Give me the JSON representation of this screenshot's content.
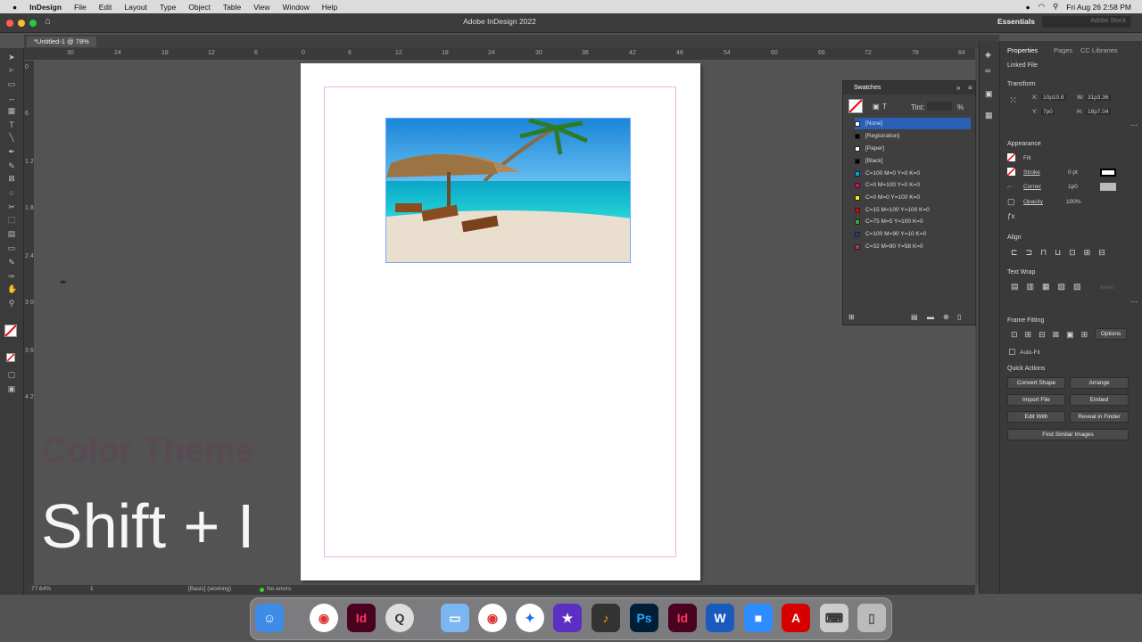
{
  "menubar": {
    "apple": "",
    "app": "InDesign",
    "items": [
      "File",
      "Edit",
      "Layout",
      "Type",
      "Object",
      "Table",
      "View",
      "Window",
      "Help"
    ],
    "datetime": "Fri Aug 26  2:58 PM"
  },
  "window": {
    "title": "Adobe InDesign 2022",
    "workspace": "Essentials",
    "stock_placeholder": "Adobe Stock"
  },
  "document": {
    "tab": "*Untitled-1 @ 78%"
  },
  "ruler": {
    "h": [
      "30",
      "24",
      "18",
      "12",
      "6",
      "0",
      "6",
      "12",
      "18",
      "24",
      "30",
      "36",
      "42",
      "48",
      "54",
      "60",
      "66",
      "72",
      "78",
      "84"
    ],
    "v": [
      "0",
      "6",
      "1 2",
      "1 8",
      "2 4",
      "3 0",
      "3 6",
      "4 2"
    ]
  },
  "overlay": {
    "feature": "Color Theme",
    "shortcut": "Shift + I"
  },
  "status": {
    "zoom": "77.64%",
    "page": "1",
    "preflight_profile": "[Basic] (working)",
    "errors": "No errors"
  },
  "swatches": {
    "title": "Swatches",
    "tint_label": "Tint:",
    "tint_unit": "%",
    "rows": [
      {
        "name": "[None]",
        "color": "#ffffff"
      },
      {
        "name": "[Registration]",
        "color": "#000000"
      },
      {
        "name": "[Paper]",
        "color": "#ffffff"
      },
      {
        "name": "[Black]",
        "color": "#000000"
      },
      {
        "name": "C=100 M=0 Y=0 K=0",
        "color": "#00a0e9"
      },
      {
        "name": "C=0 M=100 Y=0 K=0",
        "color": "#e4007f"
      },
      {
        "name": "C=0 M=0 Y=100 K=0",
        "color": "#fff100"
      },
      {
        "name": "C=15 M=100 Y=100 K=0",
        "color": "#d7000f"
      },
      {
        "name": "C=75 M=5 Y=100 K=0",
        "color": "#3aa935"
      },
      {
        "name": "C=100 M=90 Y=10 K=0",
        "color": "#1e3b8f"
      },
      {
        "name": "C=32 M=90 Y=58 K=0",
        "color": "#b03a55"
      }
    ]
  },
  "properties": {
    "tabs": [
      "Properties",
      "Pages",
      "CC Libraries"
    ],
    "linked": "Linked File",
    "transform": {
      "title": "Transform",
      "x_label": "X:",
      "x": "10p10.8",
      "y_label": "Y:",
      "y": "7p0",
      "w_label": "W:",
      "w": "31p3.36",
      "h_label": "H:",
      "h": "18p7.04"
    },
    "appearance": {
      "title": "Appearance",
      "fill": "Fill",
      "stroke": "Stroke",
      "stroke_val": "0 pt",
      "corner": "Corner",
      "corner_val": "1p0",
      "opacity": "Opacity",
      "opacity_val": "100%"
    },
    "align": "Align",
    "textwrap": {
      "title": "Text Wrap",
      "invert": "Invert"
    },
    "framefitting": {
      "title": "Frame Fitting",
      "options": "Options",
      "autofit": "Auto-Fit"
    },
    "quick": {
      "title": "Quick Actions",
      "convert": "Convert Shape",
      "arrange": "Arrange",
      "import": "Import File",
      "embed": "Embed",
      "editwith": "Edit With",
      "reveal": "Reveal in Finder",
      "similar": "Find Similar Images"
    }
  },
  "dock": [
    "Finder",
    "Chrome",
    "InDesign",
    "QuickTime",
    "Files",
    "Chrome",
    "Safari",
    "iMovie",
    "GarageBand",
    "Photoshop",
    "InDesign",
    "Word",
    "Zoom",
    "Acrobat",
    "Keyboard",
    "Trash"
  ],
  "dock_labels": {
    "id": "Id",
    "ps": "Ps",
    "w": "W",
    "acro": "A"
  }
}
